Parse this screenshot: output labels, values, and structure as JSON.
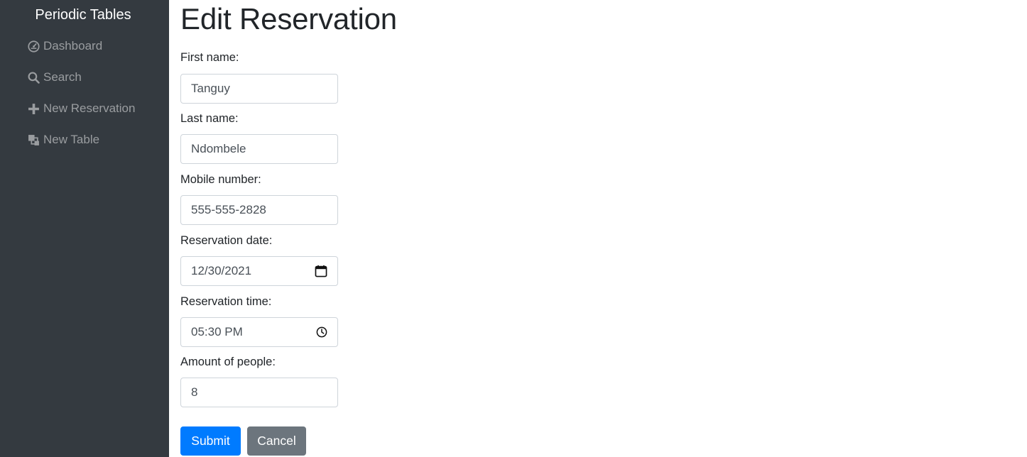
{
  "sidebar": {
    "brand": "Periodic Tables",
    "items": [
      {
        "label": "Dashboard",
        "icon": "dashboard-icon"
      },
      {
        "label": "Search",
        "icon": "search-icon"
      },
      {
        "label": "New Reservation",
        "icon": "plus-icon"
      },
      {
        "label": "New Table",
        "icon": "layers-icon"
      }
    ]
  },
  "page": {
    "title": "Edit Reservation"
  },
  "form": {
    "first_name": {
      "label": "First name:",
      "value": "Tanguy"
    },
    "last_name": {
      "label": "Last name:",
      "value": "Ndombele"
    },
    "mobile_number": {
      "label": "Mobile number:",
      "value": "555-555-2828"
    },
    "reservation_date": {
      "label": "Reservation date:",
      "value": "12/30/2021",
      "icon": "calendar-icon"
    },
    "reservation_time": {
      "label": "Reservation time:",
      "value": "05:30 PM",
      "icon": "clock-icon"
    },
    "people": {
      "label": "Amount of people:",
      "value": "8"
    },
    "submit_label": "Submit",
    "cancel_label": "Cancel"
  },
  "colors": {
    "sidebar_bg": "#343a40",
    "sidebar_text": "#9a9da0",
    "primary": "#007bff",
    "secondary": "#6c757d"
  }
}
